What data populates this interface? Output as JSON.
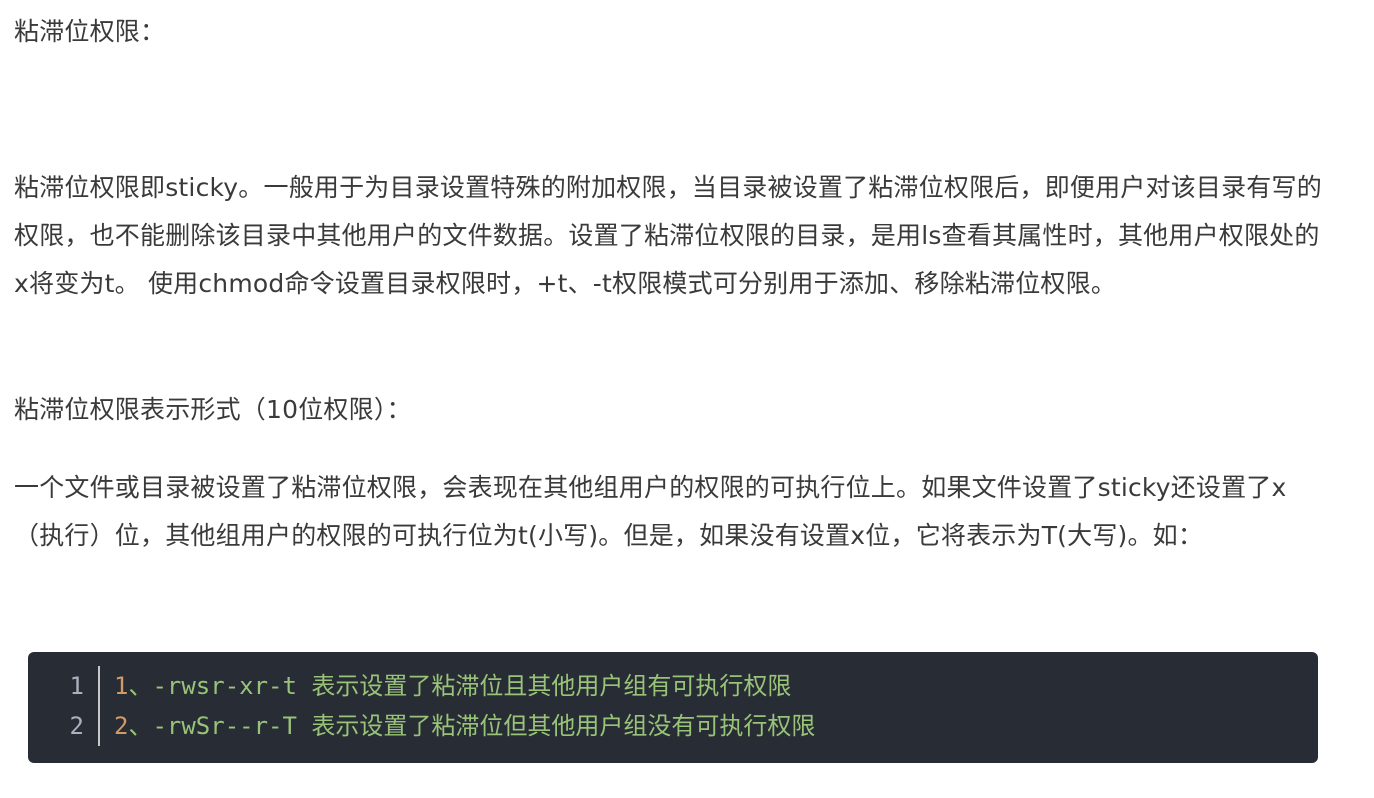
{
  "article": {
    "heading1": "粘滞位权限：",
    "intro": "粘滞位权限即sticky。一般用于为目录设置特殊的附加权限，当目录被设置了粘滞位权限后，即便用户对该目录有写的权限，也不能删除该目录中其他用户的文件数据。设置了粘滞位权限的目录，是用ls查看其属性时，其他用户权限处的x将变为t。 使用chmod命令设置目录权限时，+t、-t权限模式可分别用于添加、移除粘滞位权限。",
    "heading2": "粘滞位权限表示形式（10位权限）：",
    "detail": "一个文件或目录被设置了粘滞位权限，会表现在其他组用户的权限的可执行位上。如果文件设置了sticky还设置了x（执行）位，其他组用户的权限的可执行位为t(小写)。但是，如果没有设置x位，它将表示为T(大写)。如："
  },
  "code": {
    "lines": [
      {
        "line_number": "1",
        "number": "1",
        "text": "、-rwsr-xr-t 表示设置了粘滞位且其他用户组有可执行权限"
      },
      {
        "line_number": "2",
        "number": "2",
        "text": "、-rwSr--r-T 表示设置了粘滞位但其他用户组没有可执行权限"
      }
    ]
  },
  "colors": {
    "code_background": "#282c34",
    "code_number": "#d19a66",
    "code_text": "#98c379",
    "body_text": "#3a3a3a"
  }
}
